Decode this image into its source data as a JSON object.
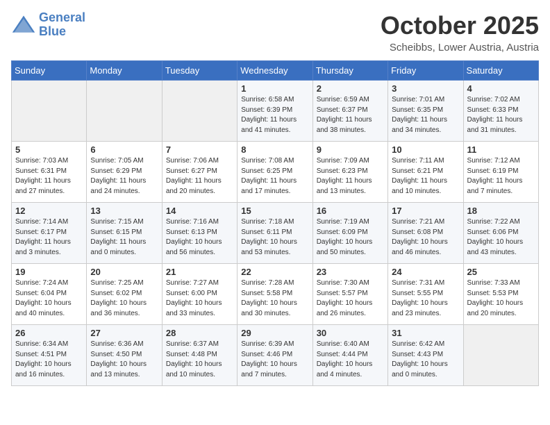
{
  "logo": {
    "line1": "General",
    "line2": "Blue"
  },
  "title": "October 2025",
  "location": "Scheibbs, Lower Austria, Austria",
  "weekdays": [
    "Sunday",
    "Monday",
    "Tuesday",
    "Wednesday",
    "Thursday",
    "Friday",
    "Saturday"
  ],
  "weeks": [
    [
      {
        "day": "",
        "info": ""
      },
      {
        "day": "",
        "info": ""
      },
      {
        "day": "",
        "info": ""
      },
      {
        "day": "1",
        "info": "Sunrise: 6:58 AM\nSunset: 6:39 PM\nDaylight: 11 hours\nand 41 minutes."
      },
      {
        "day": "2",
        "info": "Sunrise: 6:59 AM\nSunset: 6:37 PM\nDaylight: 11 hours\nand 38 minutes."
      },
      {
        "day": "3",
        "info": "Sunrise: 7:01 AM\nSunset: 6:35 PM\nDaylight: 11 hours\nand 34 minutes."
      },
      {
        "day": "4",
        "info": "Sunrise: 7:02 AM\nSunset: 6:33 PM\nDaylight: 11 hours\nand 31 minutes."
      }
    ],
    [
      {
        "day": "5",
        "info": "Sunrise: 7:03 AM\nSunset: 6:31 PM\nDaylight: 11 hours\nand 27 minutes."
      },
      {
        "day": "6",
        "info": "Sunrise: 7:05 AM\nSunset: 6:29 PM\nDaylight: 11 hours\nand 24 minutes."
      },
      {
        "day": "7",
        "info": "Sunrise: 7:06 AM\nSunset: 6:27 PM\nDaylight: 11 hours\nand 20 minutes."
      },
      {
        "day": "8",
        "info": "Sunrise: 7:08 AM\nSunset: 6:25 PM\nDaylight: 11 hours\nand 17 minutes."
      },
      {
        "day": "9",
        "info": "Sunrise: 7:09 AM\nSunset: 6:23 PM\nDaylight: 11 hours\nand 13 minutes."
      },
      {
        "day": "10",
        "info": "Sunrise: 7:11 AM\nSunset: 6:21 PM\nDaylight: 11 hours\nand 10 minutes."
      },
      {
        "day": "11",
        "info": "Sunrise: 7:12 AM\nSunset: 6:19 PM\nDaylight: 11 hours\nand 7 minutes."
      }
    ],
    [
      {
        "day": "12",
        "info": "Sunrise: 7:14 AM\nSunset: 6:17 PM\nDaylight: 11 hours\nand 3 minutes."
      },
      {
        "day": "13",
        "info": "Sunrise: 7:15 AM\nSunset: 6:15 PM\nDaylight: 11 hours\nand 0 minutes."
      },
      {
        "day": "14",
        "info": "Sunrise: 7:16 AM\nSunset: 6:13 PM\nDaylight: 10 hours\nand 56 minutes."
      },
      {
        "day": "15",
        "info": "Sunrise: 7:18 AM\nSunset: 6:11 PM\nDaylight: 10 hours\nand 53 minutes."
      },
      {
        "day": "16",
        "info": "Sunrise: 7:19 AM\nSunset: 6:09 PM\nDaylight: 10 hours\nand 50 minutes."
      },
      {
        "day": "17",
        "info": "Sunrise: 7:21 AM\nSunset: 6:08 PM\nDaylight: 10 hours\nand 46 minutes."
      },
      {
        "day": "18",
        "info": "Sunrise: 7:22 AM\nSunset: 6:06 PM\nDaylight: 10 hours\nand 43 minutes."
      }
    ],
    [
      {
        "day": "19",
        "info": "Sunrise: 7:24 AM\nSunset: 6:04 PM\nDaylight: 10 hours\nand 40 minutes."
      },
      {
        "day": "20",
        "info": "Sunrise: 7:25 AM\nSunset: 6:02 PM\nDaylight: 10 hours\nand 36 minutes."
      },
      {
        "day": "21",
        "info": "Sunrise: 7:27 AM\nSunset: 6:00 PM\nDaylight: 10 hours\nand 33 minutes."
      },
      {
        "day": "22",
        "info": "Sunrise: 7:28 AM\nSunset: 5:58 PM\nDaylight: 10 hours\nand 30 minutes."
      },
      {
        "day": "23",
        "info": "Sunrise: 7:30 AM\nSunset: 5:57 PM\nDaylight: 10 hours\nand 26 minutes."
      },
      {
        "day": "24",
        "info": "Sunrise: 7:31 AM\nSunset: 5:55 PM\nDaylight: 10 hours\nand 23 minutes."
      },
      {
        "day": "25",
        "info": "Sunrise: 7:33 AM\nSunset: 5:53 PM\nDaylight: 10 hours\nand 20 minutes."
      }
    ],
    [
      {
        "day": "26",
        "info": "Sunrise: 6:34 AM\nSunset: 4:51 PM\nDaylight: 10 hours\nand 16 minutes."
      },
      {
        "day": "27",
        "info": "Sunrise: 6:36 AM\nSunset: 4:50 PM\nDaylight: 10 hours\nand 13 minutes."
      },
      {
        "day": "28",
        "info": "Sunrise: 6:37 AM\nSunset: 4:48 PM\nDaylight: 10 hours\nand 10 minutes."
      },
      {
        "day": "29",
        "info": "Sunrise: 6:39 AM\nSunset: 4:46 PM\nDaylight: 10 hours\nand 7 minutes."
      },
      {
        "day": "30",
        "info": "Sunrise: 6:40 AM\nSunset: 4:44 PM\nDaylight: 10 hours\nand 4 minutes."
      },
      {
        "day": "31",
        "info": "Sunrise: 6:42 AM\nSunset: 4:43 PM\nDaylight: 10 hours\nand 0 minutes."
      },
      {
        "day": "",
        "info": ""
      }
    ]
  ]
}
